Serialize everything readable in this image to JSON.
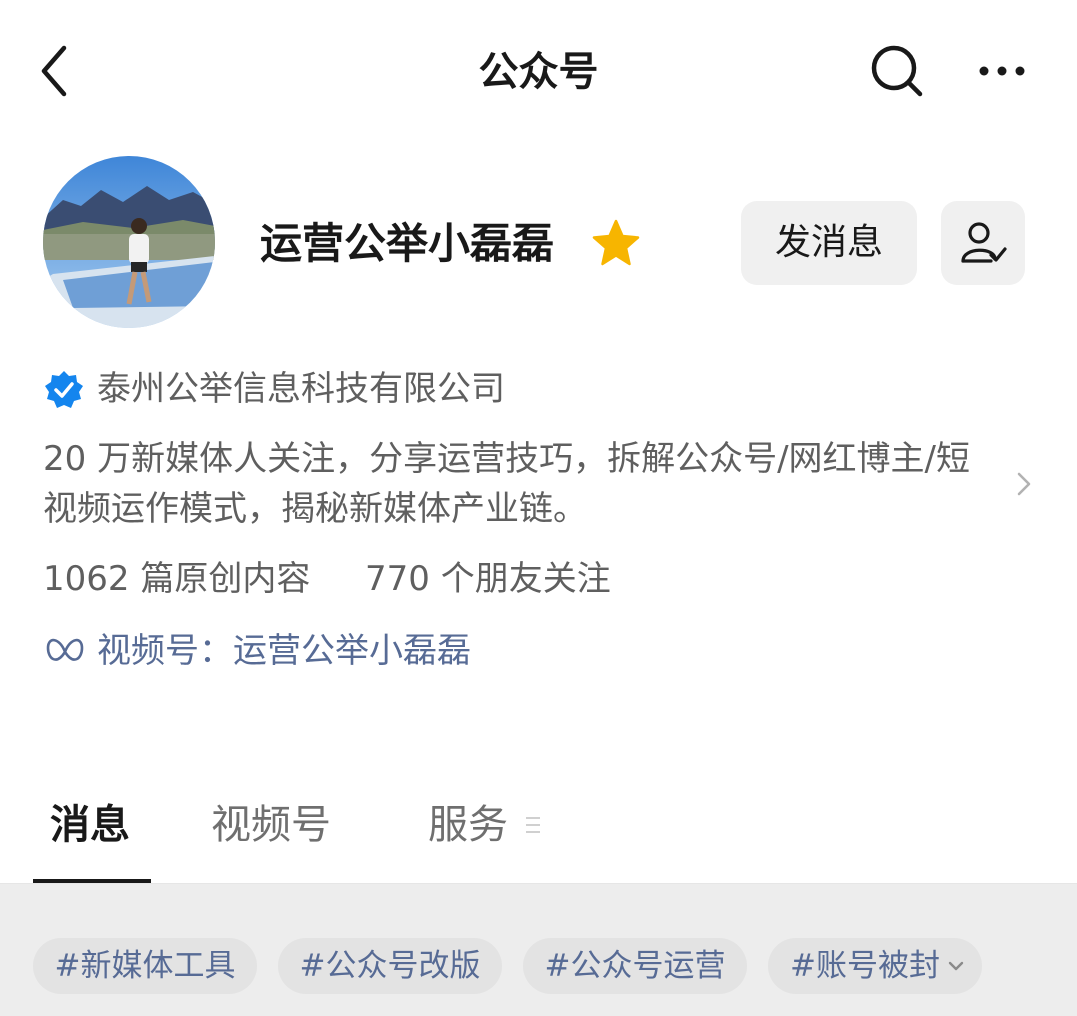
{
  "header": {
    "title": "公众号"
  },
  "icons": {
    "back": "chevron-left-icon",
    "search": "search-icon",
    "more": "more-horizontal-icon",
    "star": "star-icon",
    "follow": "user-check-icon",
    "verified": "verified-badge-icon",
    "chevron": "chevron-right-icon",
    "channels": "channels-butterfly-icon"
  },
  "colors": {
    "star": "#f7b500",
    "verified": "#1485ee",
    "link": "#576b95",
    "button_bg": "#f0f0f0",
    "tag_area_bg": "#ededed"
  },
  "profile": {
    "name": "运营公举小磊磊",
    "send_message_label": "发消息",
    "company": "泰州公举信息科技有限公司",
    "description": "20 万新媒体人关注，分享运营技巧，拆解公众号/网红博主/短视频运作模式，揭秘新媒体产业链。",
    "stats": {
      "articles": "1062 篇原创内容",
      "friends": "770 个朋友关注"
    },
    "channels_link": "视频号：运营公举小磊磊"
  },
  "tabs": [
    {
      "label": "消息",
      "active": true
    },
    {
      "label": "视频号",
      "active": false
    },
    {
      "label": "服务",
      "active": false
    }
  ],
  "tags": [
    "#新媒体工具",
    "#公众号改版",
    "#公众号运营",
    "#账号被封"
  ]
}
